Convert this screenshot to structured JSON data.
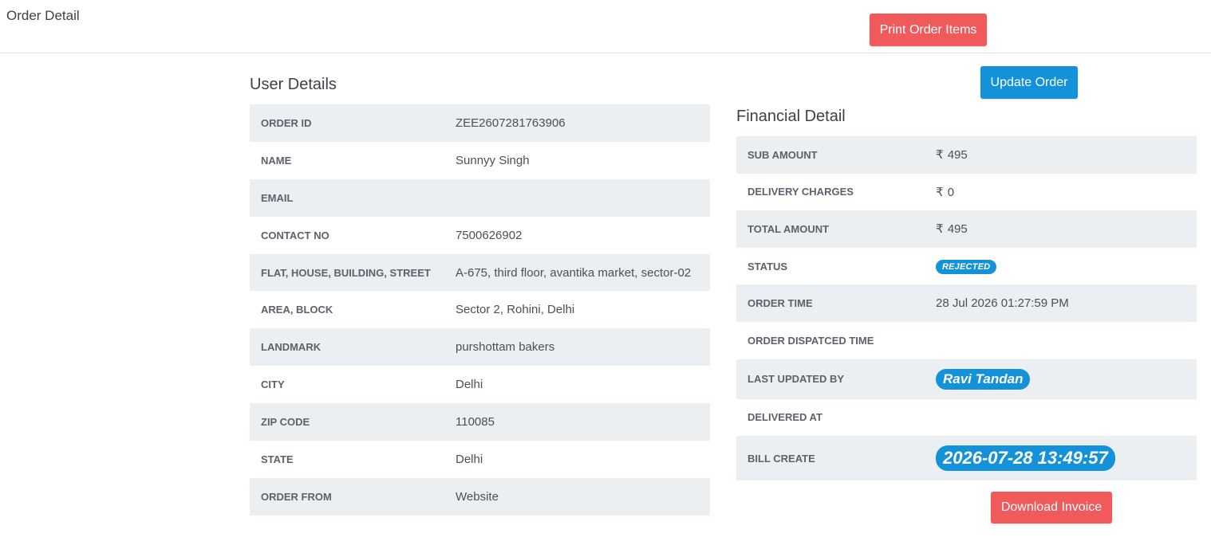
{
  "header": {
    "title": "Order Detail",
    "print_label": "Print Order Items"
  },
  "actions": {
    "update_label": "Update Order",
    "download_label": "Download Invoice"
  },
  "user_details": {
    "title": "User Details",
    "rows": [
      {
        "label": "ORDER ID",
        "value": "ZEE2607281763906"
      },
      {
        "label": "NAME",
        "value": "Sunnyy Singh"
      },
      {
        "label": "EMAIL",
        "value": ""
      },
      {
        "label": "CONTACT NO",
        "value": "7500626902"
      },
      {
        "label": "FLAT, HOUSE, BUILDING, STREET",
        "value": "A-675, third floor, avantika market, sector-02"
      },
      {
        "label": "AREA, BLOCK",
        "value": "Sector 2, Rohini, Delhi"
      },
      {
        "label": "LANDMARK",
        "value": "purshottam bakers"
      },
      {
        "label": "CITY",
        "value": "Delhi"
      },
      {
        "label": "ZIP CODE",
        "value": "110085"
      },
      {
        "label": "STATE",
        "value": "Delhi"
      },
      {
        "label": "ORDER FROM",
        "value": "Website"
      }
    ]
  },
  "financial_detail": {
    "title": "Financial Detail",
    "currency_symbol": "₹",
    "rows": [
      {
        "label": "SUB AMOUNT",
        "value": "495"
      },
      {
        "label": "DELIVERY CHARGES",
        "value": "0"
      },
      {
        "label": "TOTAL AMOUNT",
        "value": "495"
      },
      {
        "label": "STATUS",
        "value": "REJECTED"
      },
      {
        "label": "ORDER TIME",
        "value": "28 Jul 2026 01:27:59 PM"
      },
      {
        "label": "ORDER DISPATCED TIME",
        "value": ""
      },
      {
        "label": "LAST UPDATED BY",
        "value": "Ravi Tandan"
      },
      {
        "label": "DELIVERED AT",
        "value": ""
      },
      {
        "label": "BILL CREATE",
        "value": "2026-07-28 13:49:57"
      }
    ]
  },
  "colors": {
    "primary": "#1392d9",
    "danger": "#f15a5a",
    "row_stripe": "#eceff2"
  }
}
